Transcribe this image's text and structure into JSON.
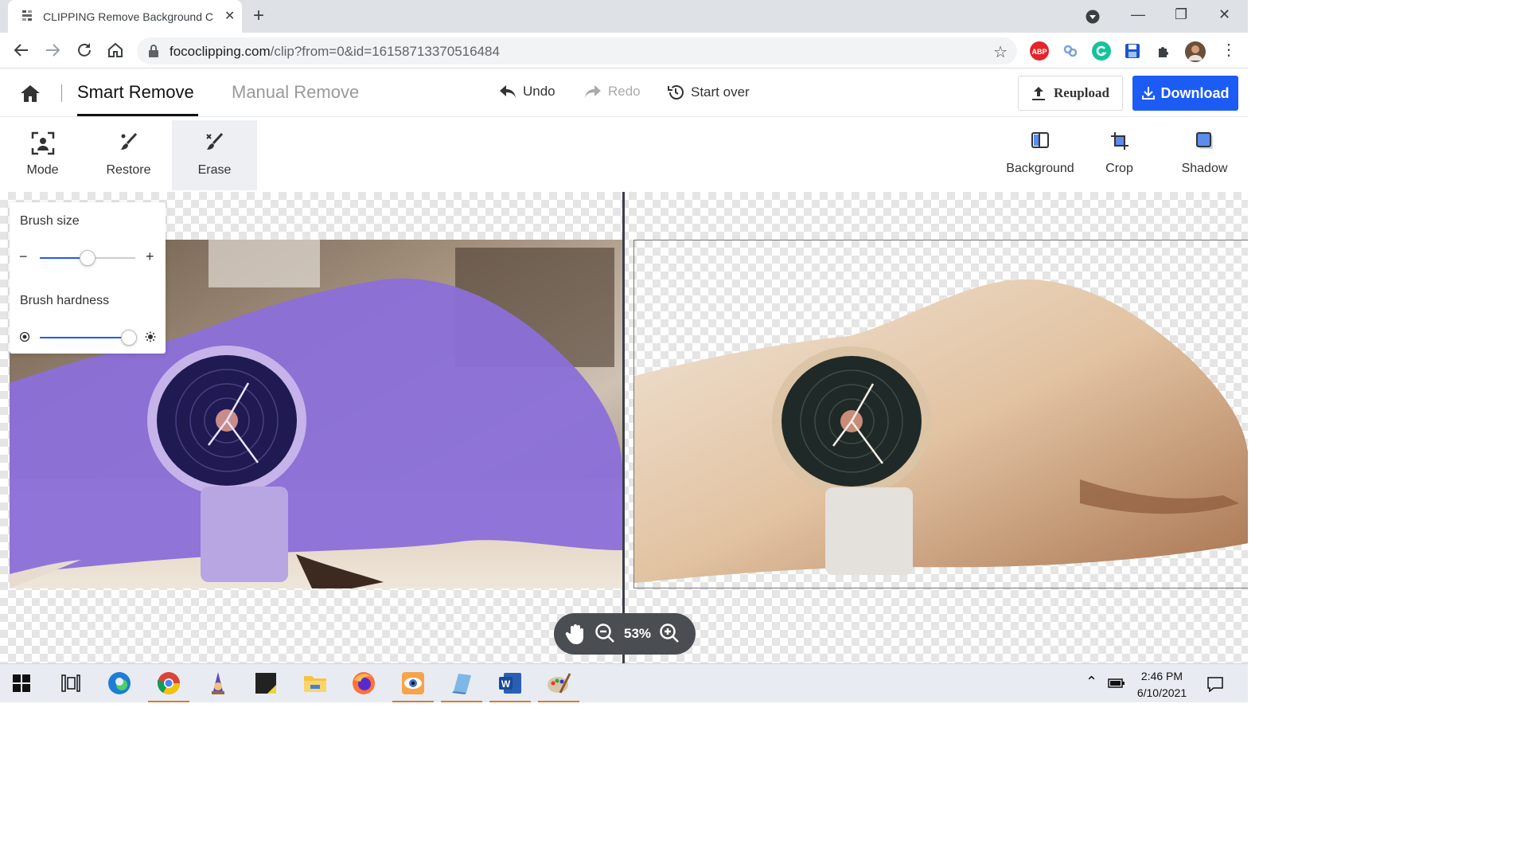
{
  "browser": {
    "tab_title": "CLIPPING Remove Background C",
    "url_host": "fococlipping.com",
    "url_path": "/clip?from=0&id=16158713370516484"
  },
  "app": {
    "mode_tabs": [
      "Smart Remove",
      "Manual Remove"
    ],
    "active_mode": "Smart Remove",
    "undo_label": "Undo",
    "redo_label": "Redo",
    "start_over_label": "Start over",
    "reupload_label": "Reupload",
    "download_label": "Download",
    "accent_color": "#1c5cf5"
  },
  "toolbar": {
    "left": [
      {
        "label": "Mode",
        "icon": "user-frame-icon"
      },
      {
        "label": "Restore",
        "icon": "brush-restore-icon"
      },
      {
        "label": "Erase",
        "icon": "brush-erase-icon",
        "active": true
      }
    ],
    "right": [
      {
        "label": "Background",
        "icon": "background-icon"
      },
      {
        "label": "Crop",
        "icon": "crop-icon"
      },
      {
        "label": "Shadow",
        "icon": "shadow-icon"
      }
    ]
  },
  "brush_panel": {
    "size_label": "Brush size",
    "size_value": 0.5,
    "hardness_label": "Brush hardness",
    "hardness_value": 0.93
  },
  "zoom": {
    "percent": "53%"
  },
  "taskbar": {
    "time": "2:46 PM",
    "date": "6/10/2021"
  }
}
